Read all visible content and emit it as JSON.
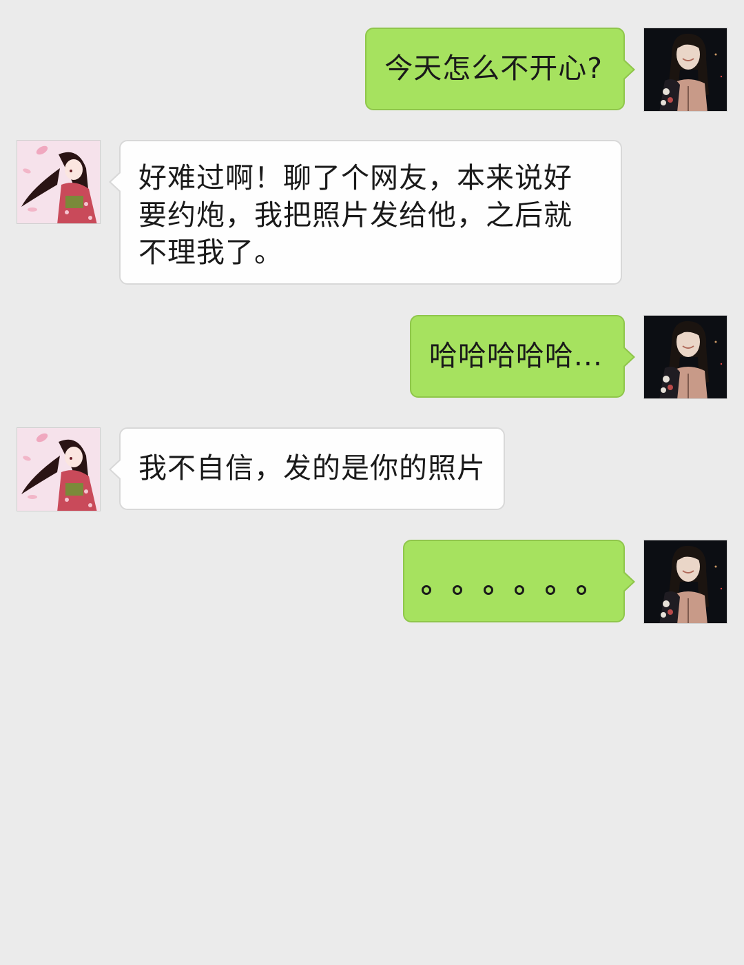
{
  "messages": [
    {
      "side": "me",
      "text": "今天怎么不开心?"
    },
    {
      "side": "them",
      "text": "好难过啊！聊了个网友，本来说好\n要约炮，我把照片发给他，之后就\n不理我了。"
    },
    {
      "side": "me",
      "text": "哈哈哈哈哈..."
    },
    {
      "side": "them",
      "text": "我不自信，发的是你的照片"
    },
    {
      "side": "me",
      "text": "。。。。。。"
    }
  ],
  "avatars": {
    "me": "photo-avatar-woman-smiling",
    "them": "anime-avatar-girl-kimono"
  },
  "colors": {
    "background": "#ebebeb",
    "my_bubble": "#a6e25f",
    "their_bubble": "#fefefe"
  }
}
